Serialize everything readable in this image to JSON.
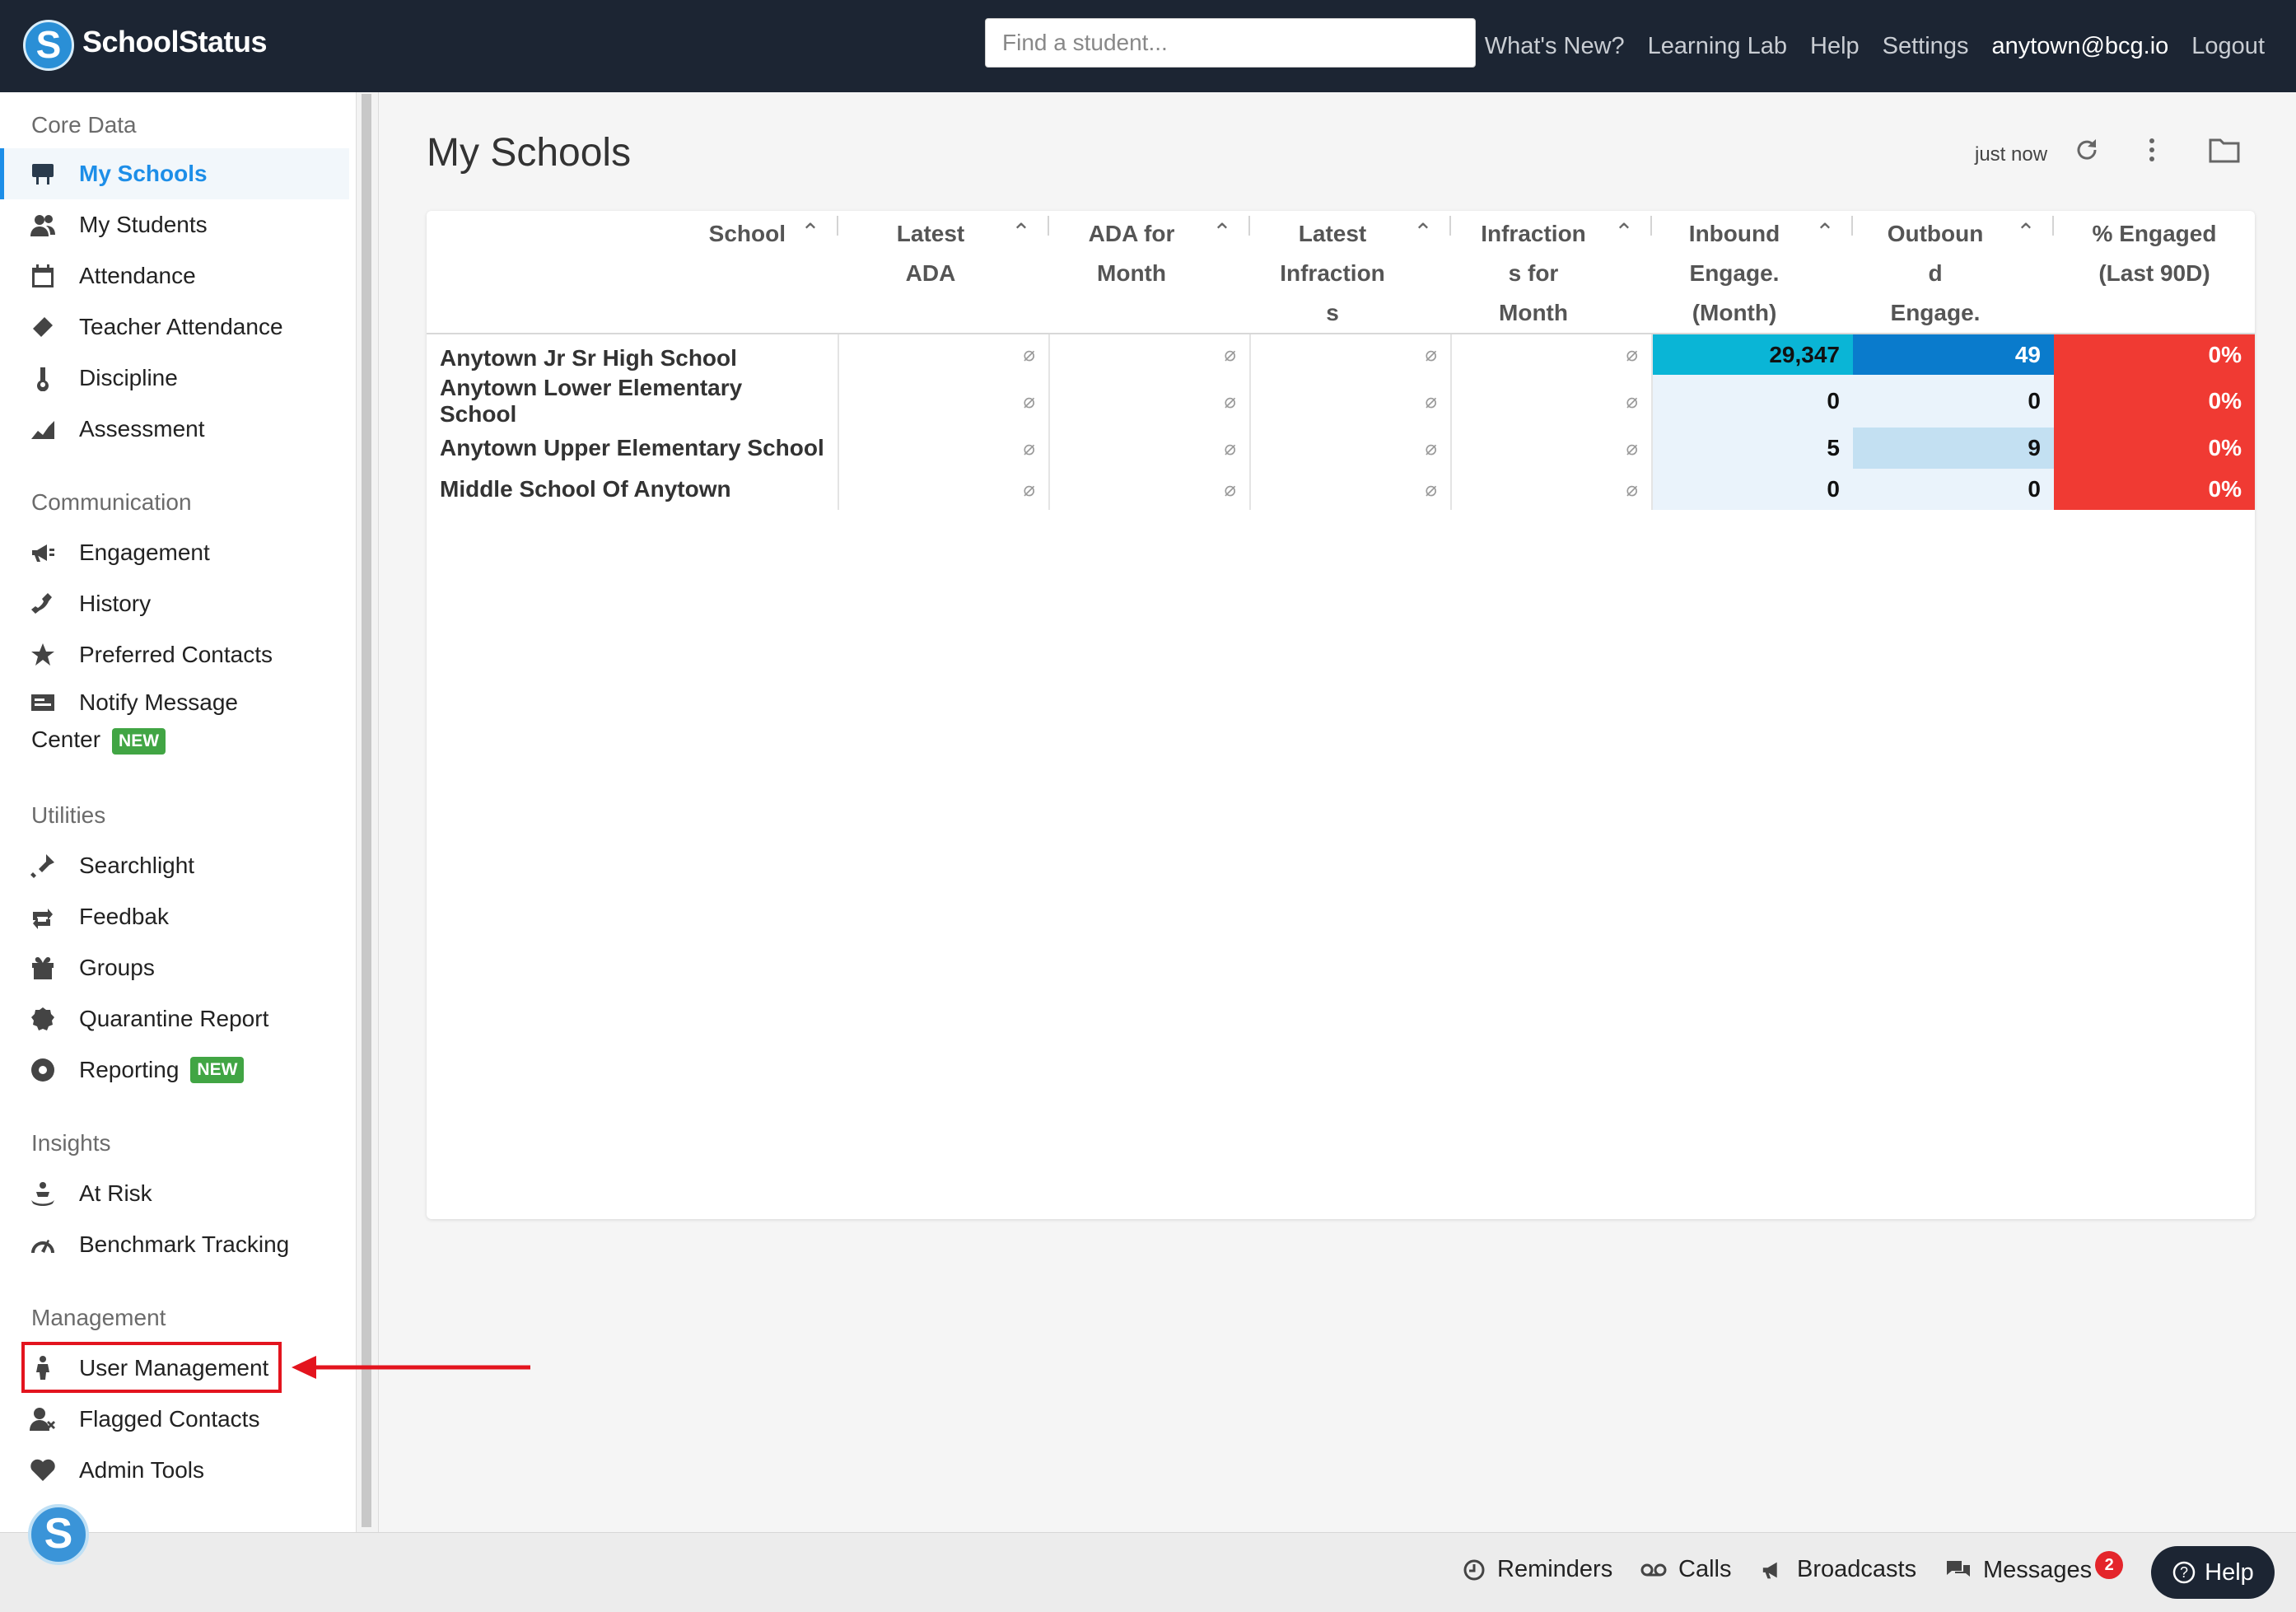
{
  "topbar": {
    "brand_initial": "S",
    "brand": "SchoolStatus",
    "search_placeholder": "Find a student...",
    "links": [
      "What's New?",
      "Learning Lab",
      "Help",
      "Settings",
      "anytown@bcg.io",
      "Logout"
    ]
  },
  "sidebar": {
    "core_data": {
      "title": "Core Data",
      "items": [
        "My Schools",
        "My Students",
        "Attendance",
        "Teacher Attendance",
        "Discipline",
        "Assessment"
      ]
    },
    "communication": {
      "title": "Communication",
      "items": [
        "Engagement",
        "History",
        "Preferred Contacts"
      ],
      "notify_line1": "Notify Message",
      "notify_line2": "Center",
      "new_badge": "NEW"
    },
    "utilities": {
      "title": "Utilities",
      "items": [
        "Searchlight",
        "Feedbak",
        "Groups",
        "Quarantine Report",
        "Reporting"
      ],
      "new_badge": "NEW"
    },
    "insights": {
      "title": "Insights",
      "items": [
        "At Risk",
        "Benchmark Tracking"
      ]
    },
    "management": {
      "title": "Management",
      "items": [
        "User Management",
        "Flagged Contacts",
        "Admin Tools"
      ]
    }
  },
  "main": {
    "title": "My Schools",
    "refreshed": "just now",
    "table": {
      "headers": [
        "School",
        "Latest\nADA",
        "ADA for\nMonth",
        "Latest\nInfraction\ns",
        "Infraction\ns for\nMonth",
        "Inbound\nEngage.\n(Month)",
        "Outboun\nd\nEngage.",
        "% Engaged\n(Last 90D)"
      ],
      "null_symbol": "⌀",
      "rows": [
        {
          "school": "Anytown Jr Sr High School",
          "inbound": "29,347",
          "outbound": "49",
          "engaged": "0%"
        },
        {
          "school": "Anytown Lower Elementary School",
          "inbound": "0",
          "outbound": "0",
          "engaged": "0%"
        },
        {
          "school": "Anytown Upper Elementary School",
          "inbound": "5",
          "outbound": "9",
          "engaged": "0%"
        },
        {
          "school": "Middle School Of Anytown",
          "inbound": "0",
          "outbound": "0",
          "engaged": "0%"
        }
      ]
    }
  },
  "bottombar": {
    "reminders": "Reminders",
    "calls": "Calls",
    "broadcasts": "Broadcasts",
    "messages": "Messages",
    "messages_count": "2",
    "help": "Help"
  },
  "colors": {
    "navbar": "#1c2533",
    "active_accent": "#1d8ee8",
    "inbound_high": "#0ab5d6",
    "outbound_high": "#0a7bcc",
    "outbound_mid": "#c3e0f2",
    "cell_low": "#eaf3fb",
    "engaged_red": "#f03a33",
    "new_badge": "#41a544",
    "annotation_red": "#e3141e"
  }
}
